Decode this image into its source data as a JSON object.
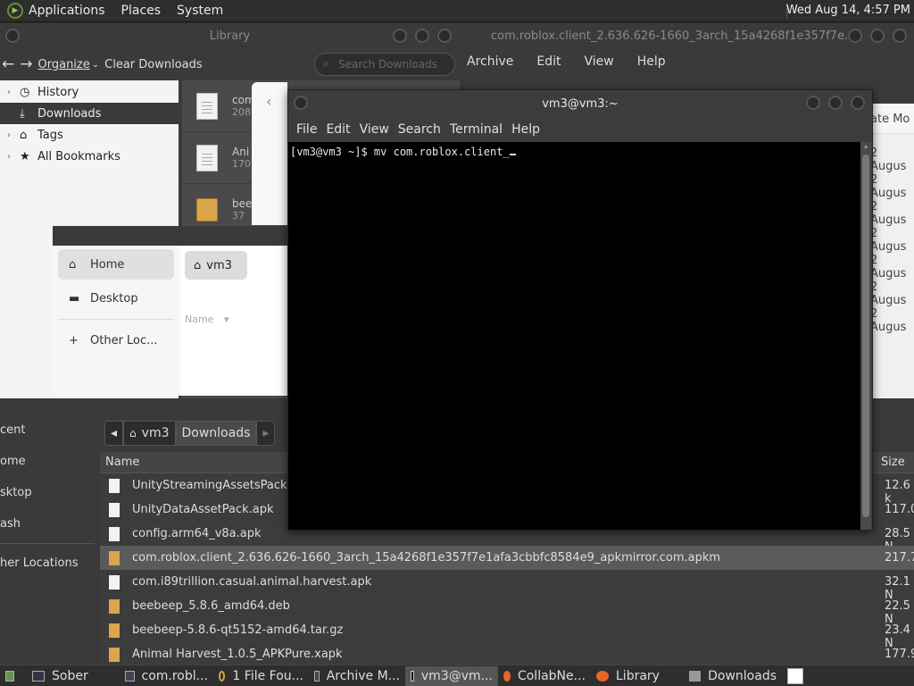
{
  "top_panel": {
    "menus": [
      "Applications",
      "Places",
      "System"
    ],
    "clock": "Wed Aug 14,  4:57 PM"
  },
  "library": {
    "title": "Library",
    "organize": "Organize",
    "clear_downloads": "Clear Downloads",
    "search_placeholder": "Search Downloads",
    "sidebar": [
      "History",
      "Downloads",
      "Tags",
      "All Bookmarks"
    ],
    "items": [
      {
        "name": "com",
        "meta": "208"
      },
      {
        "name": "Ani",
        "meta": "170"
      },
      {
        "name": "bee",
        "meta": "37"
      }
    ]
  },
  "archive": {
    "title": "com.roblox.client_2.636.626-1660_3arch_15a4268f1e357f7e...",
    "menus": [
      "Archive",
      "Edit",
      "View",
      "Help"
    ],
    "column_header": "ate Mo",
    "dates": [
      "2 Augus",
      "2 Augus",
      "2 Augus",
      "2 Augus",
      "2 Augus",
      "2 Augus",
      "2 Augus"
    ]
  },
  "files_window": {
    "sidebar": [
      "Home",
      "Desktop",
      "Other Loc..."
    ],
    "crumb": "vm3",
    "column": "Name"
  },
  "file_manager": {
    "sidebar": [
      "cent",
      "ome",
      "sktop",
      "ash",
      "her Locations"
    ],
    "path": [
      "vm3",
      "Downloads"
    ],
    "columns": {
      "name": "Name",
      "size": "Size"
    },
    "rows": [
      {
        "name": "UnityStreamingAssetsPack.apk",
        "size": "12.6 k",
        "kind": "file"
      },
      {
        "name": "UnityDataAssetPack.apk",
        "size": "117.0",
        "kind": "file"
      },
      {
        "name": "config.arm64_v8a.apk",
        "size": "28.5 N",
        "kind": "file"
      },
      {
        "name": "com.roblox.client_2.636.626-1660_3arch_15a4268f1e357f7e1afa3cbbfc8584e9_apkmirror.com.apkm",
        "size": "217.7",
        "kind": "package"
      },
      {
        "name": "com.i89trillion.casual.animal.harvest.apk",
        "size": "32.1 N",
        "kind": "file"
      },
      {
        "name": "beebeep_5.8.6_amd64.deb",
        "size": "22.5 N",
        "kind": "package"
      },
      {
        "name": "beebeep-5.8.6-qt5152-amd64.tar.gz",
        "size": "23.4 N",
        "kind": "package"
      },
      {
        "name": "Animal Harvest_1.0.5_APKPure.xapk",
        "size": "177.9",
        "kind": "package"
      }
    ]
  },
  "terminal": {
    "title": "vm3@vm3:~",
    "menus": [
      "File",
      "Edit",
      "View",
      "Search",
      "Terminal",
      "Help"
    ],
    "line": "[vm3@vm3 ~]$ mv com.roblox.client_"
  },
  "taskbar": {
    "tasks": [
      "Sober",
      "com.robl...",
      "1 File Fou...",
      "Archive M...",
      "vm3@vm...",
      "CollabNe...",
      "Library",
      "Downloads"
    ]
  }
}
